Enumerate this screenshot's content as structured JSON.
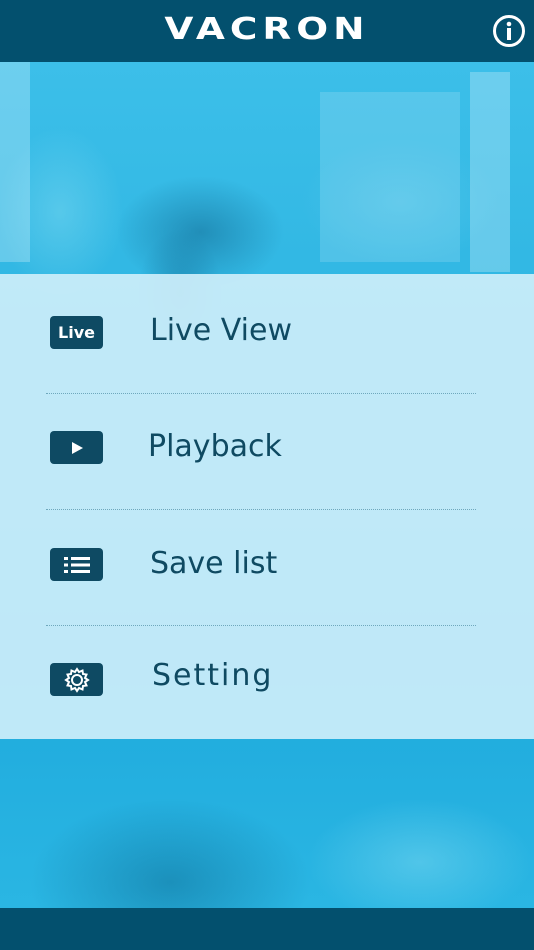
{
  "header": {
    "logo_text": "VACRON",
    "info_icon": "info-icon"
  },
  "menu": {
    "items": [
      {
        "label": "Live View",
        "icon": "live-icon",
        "icon_text": "Live"
      },
      {
        "label": "Playback",
        "icon": "play-icon"
      },
      {
        "label": "Save list",
        "icon": "list-icon"
      },
      {
        "label": "Setting",
        "icon": "gear-icon"
      }
    ]
  },
  "colors": {
    "header_bg": "#03506e",
    "menu_bg": "#cdeefa",
    "label": "#0f4a62",
    "background_tint": "#1aa8d8"
  }
}
